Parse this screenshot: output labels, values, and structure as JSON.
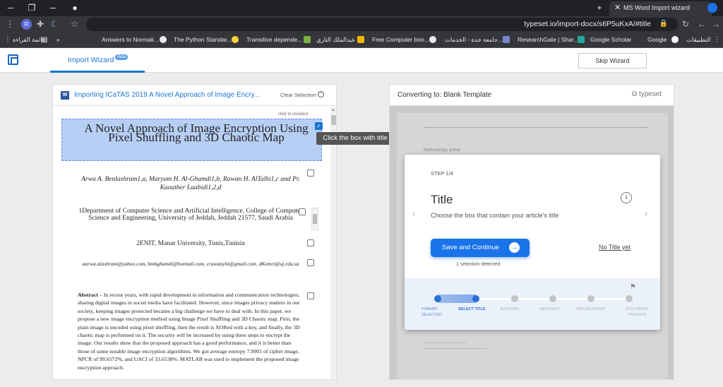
{
  "browser": {
    "tab_title": "MS Word Import wizard",
    "url": "typeset.io/import-docx/s6P5uKxA/#title",
    "profile_initial": "R",
    "bookmarks": [
      "قائمة القراءة",
      "Answers to Normali...",
      "The Python Standar...",
      "Transitive depende...",
      "عبدالملك الثاري",
      "Free Computer boo...",
      "جامعة جدة - الخدمات...",
      "ResearchGate | Shar...",
      "Google Scholar",
      "Google",
      "التطبيقات"
    ]
  },
  "header": {
    "tab_label": "Import Wizard",
    "beta_badge": "Beta",
    "skip_button": "Skip Wizard"
  },
  "left_panel": {
    "title": "Importing ICaTAS 2019 A Novel Approach of Image Encry...",
    "clear_selection": "Clear Selection",
    "click_to_unselect": "click to unselect",
    "doc_title": "A Novel Approach of Image Encryption Using Pixel Shuffling and 3D Chaotic Map",
    "authors": "Arwa A. Benlashram1,a, Maryam H. Al-Ghamdi1,b, Rawan H. AlTalhi1,c and Pr. Kaouther Laabidi1,2,d",
    "affiliation1": "1Department of Computer Science and Artificial Intelligence, College of Computer Science and Engineering, University of Jeddah, Jeddah 21577, Saudi Arabia",
    "affiliation2": "2ENIT, Manar University, Tunis,Tunisia",
    "emails": "aarwa.alashram@yahoo.com, bmhghamdi@hotmail.com, crawanyht@gmail.com, dKomri@uj.edu.sa",
    "abstract_label": "Abstract",
    "abstract_text": " – In recent years, with rapid development in information and communication technologies, sharing digital images in social media have facilitated. However, since images privacy matters in our society, keeping images protected became a big challenge we have to deal with. In this paper, we propose a new image encryption method using Image Pixel Shuffling and 3D Chaotic map. First, the plain image is encoded using pixel shuffling, then the result is XORed with a key, and finally, the 3D chaotic map is performed on it. The security will be increased by using three steps to encrypt the image. Our results show that the proposed approach has a good performance, and it is better than those of some notable image encryption algorithms. We got average entropy 7.9901 of cipher image, NPCR of 99.6572%, and UACI of 33.6538%. MATLAB was used to implement the proposed image encryption approach.",
    "tooltip": "Click the box with title"
  },
  "right_panel": {
    "title": "Converting to: Blank Template",
    "logo": "typeset",
    "preview_label": "Methodology article"
  },
  "modal": {
    "step": "STEP 1/4",
    "title": "Title",
    "subtitle": "Choose the box that contain your article's title",
    "save_button": "Save and Continue",
    "no_title": "No Title yet",
    "selection_detected": "1 selection detected",
    "steps": [
      {
        "label": "FORMAT SELECTED",
        "status": "done"
      },
      {
        "label": "SELECT TITLE",
        "status": "active"
      },
      {
        "label": "AUTHORS",
        "status": "todo"
      },
      {
        "label": "ABSTRACT",
        "status": "todo"
      },
      {
        "label": "BIBLIOGRAPHY",
        "status": "todo"
      },
      {
        "label": "DOCUMENT PREVIEW",
        "status": "todo"
      }
    ]
  }
}
